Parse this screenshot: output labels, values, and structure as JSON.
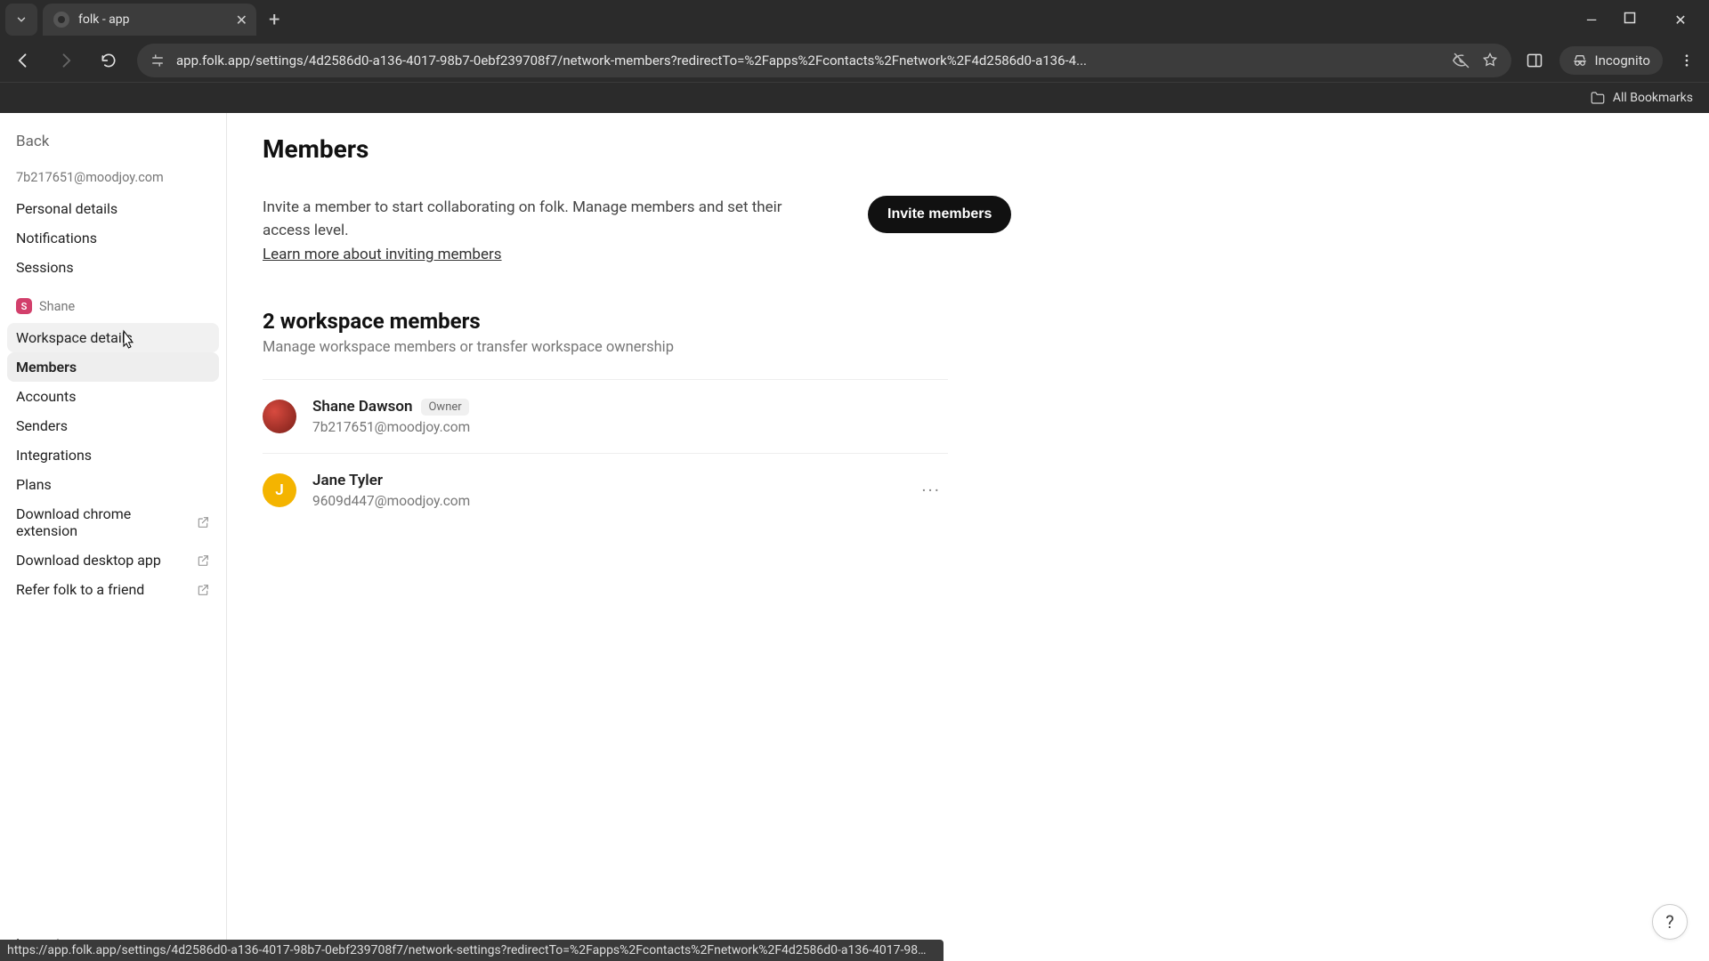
{
  "browser": {
    "tab_title": "folk - app",
    "url_display": "app.folk.app/settings/4d2586d0-a136-4017-98b7-0ebf239708f7/network-members?redirectTo=%2Fapps%2Fcontacts%2Fnetwork%2F4d2586d0-a136-4...",
    "incognito_label": "Incognito",
    "all_bookmarks": "All Bookmarks"
  },
  "sidebar": {
    "back": "Back",
    "user_email": "7b217651@moodjoy.com",
    "personal_items": [
      "Personal details",
      "Notifications",
      "Sessions"
    ],
    "workspace_name": "Shane",
    "workspace_items": [
      "Workspace details",
      "Members",
      "Accounts",
      "Senders",
      "Integrations",
      "Plans",
      "Download chrome extension",
      "Download desktop app",
      "Refer folk to a friend"
    ],
    "logout": "Logout"
  },
  "main": {
    "title": "Members",
    "intro": "Invite a member to start collaborating on folk. Manage members and set their access level.",
    "learn_more": "Learn more about inviting members",
    "invite_button": "Invite members",
    "section_heading": "2 workspace members",
    "section_sub": "Manage workspace members or transfer workspace ownership",
    "members": [
      {
        "name": "Shane Dawson",
        "email": "7b217651@moodjoy.com",
        "badge": "Owner",
        "avatar_type": "image",
        "avatar_bg": "",
        "avatar_initial": ""
      },
      {
        "name": "Jane Tyler",
        "email": "9609d447@moodjoy.com",
        "badge": "",
        "avatar_type": "initial",
        "avatar_bg": "#f4b400",
        "avatar_initial": "J"
      }
    ]
  },
  "status_url": "https://app.folk.app/settings/4d2586d0-a136-4017-98b7-0ebf239708f7/network-settings?redirectTo=%2Fapps%2Fcontacts%2Fnetwork%2F4d2586d0-a136-4017-98b7-0ebf239708f7%...",
  "help_label": "?"
}
